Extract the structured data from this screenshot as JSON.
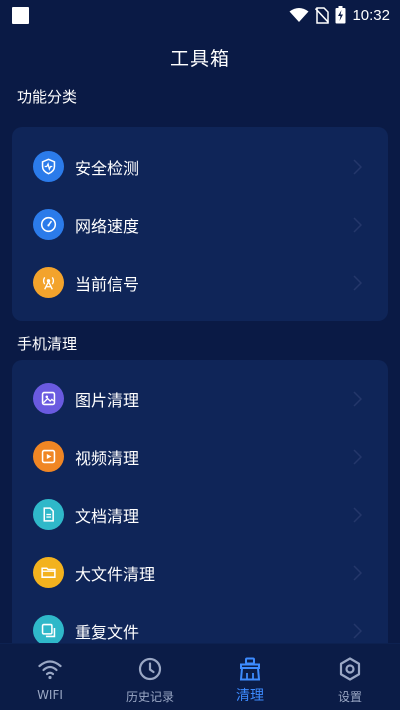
{
  "status_bar": {
    "time": "10:32",
    "icons": [
      "app-notification-square-icon",
      "wifi-icon",
      "no-sim-icon",
      "battery-charging-icon"
    ]
  },
  "header": {
    "title": "工具箱"
  },
  "sections": [
    {
      "title": "功能分类",
      "items": [
        {
          "label": "安全检测",
          "icon": "shield-check-icon",
          "color": "#2b7bea"
        },
        {
          "label": "网络速度",
          "icon": "speedometer-icon",
          "color": "#2b7bea"
        },
        {
          "label": "当前信号",
          "icon": "signal-tower-icon",
          "color": "#f3a32c"
        }
      ]
    },
    {
      "title": "手机清理",
      "items": [
        {
          "label": "图片清理",
          "icon": "image-icon",
          "color": "#6a5ae0"
        },
        {
          "label": "视频清理",
          "icon": "video-play-icon",
          "color": "#f08624"
        },
        {
          "label": "文档清理",
          "icon": "document-icon",
          "color": "#2fb8c9"
        },
        {
          "label": "大文件清理",
          "icon": "folder-icon",
          "color": "#f3b21e"
        },
        {
          "label": "重复文件",
          "icon": "duplicate-icon",
          "color": "#2fb8c9"
        }
      ]
    }
  ],
  "bottom_nav": [
    {
      "label": "WIFI",
      "icon": "wifi-icon",
      "active": false
    },
    {
      "label": "历史记录",
      "icon": "clock-icon",
      "active": false
    },
    {
      "label": "清理",
      "icon": "broom-clean-icon",
      "active": true
    },
    {
      "label": "设置",
      "icon": "settings-hexagon-icon",
      "active": false
    }
  ],
  "colors": {
    "background": "#0a1a45",
    "card": "#0f2558",
    "accent": "#3d8bff",
    "nav_inactive": "#9aa7c4"
  }
}
